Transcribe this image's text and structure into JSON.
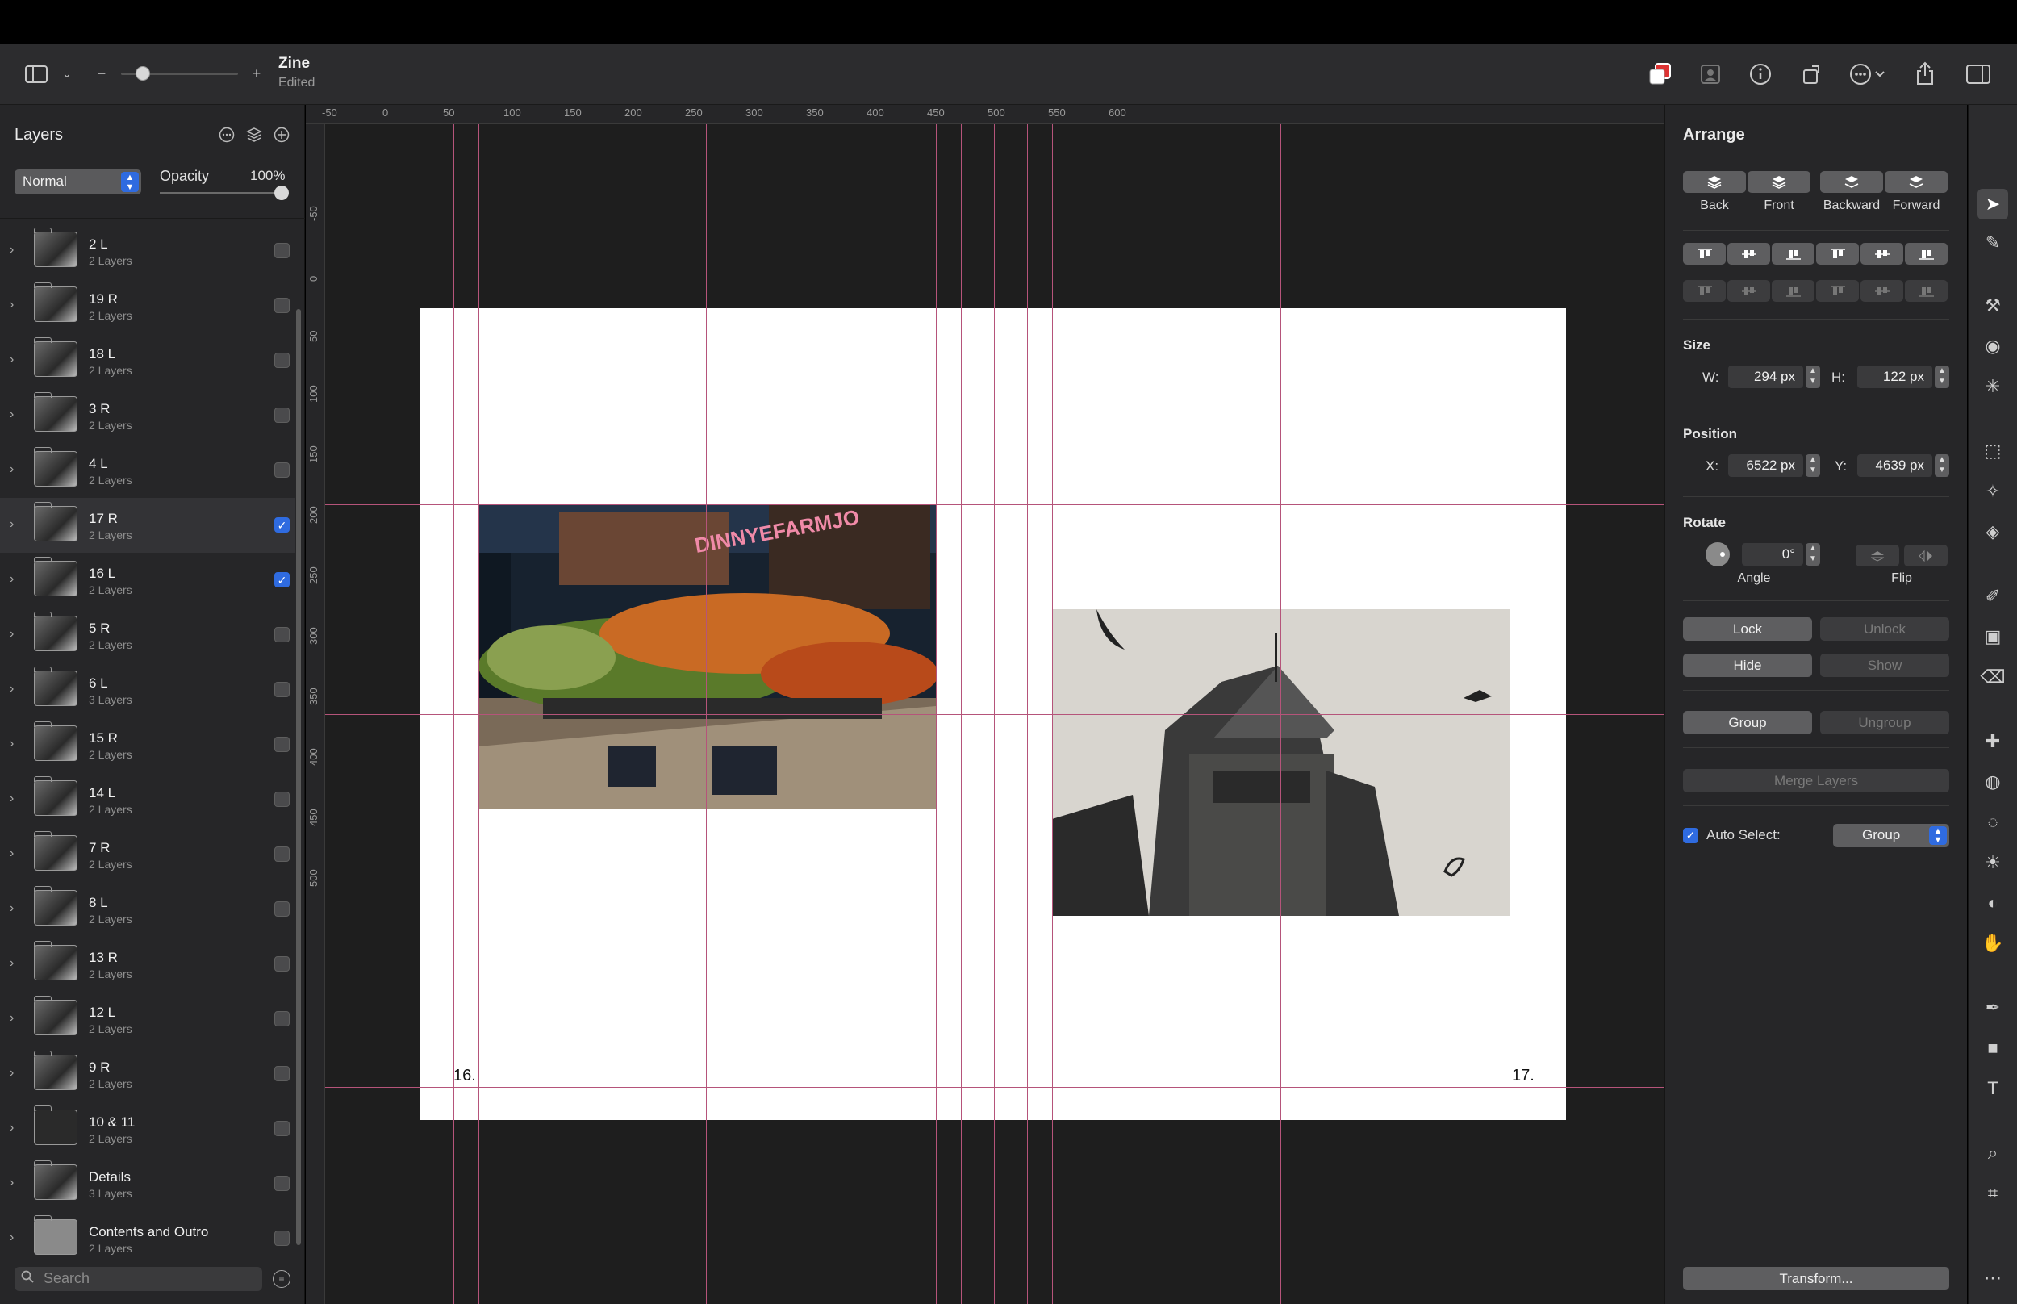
{
  "document": {
    "title": "Zine",
    "status": "Edited"
  },
  "toolbar": {
    "zoom_minus": "−",
    "zoom_plus": "+"
  },
  "layers_panel": {
    "title": "Layers",
    "blend_mode": "Normal",
    "opacity_label": "Opacity",
    "opacity_value": "100%",
    "search_placeholder": "Search",
    "layers": [
      {
        "name": "2 L",
        "count": "2 Layers",
        "visible": false,
        "selected": false
      },
      {
        "name": "19 R",
        "count": "2 Layers",
        "visible": false,
        "selected": false
      },
      {
        "name": "18 L",
        "count": "2 Layers",
        "visible": false,
        "selected": false
      },
      {
        "name": "3 R",
        "count": "2 Layers",
        "visible": false,
        "selected": false
      },
      {
        "name": "4 L",
        "count": "2 Layers",
        "visible": false,
        "selected": false
      },
      {
        "name": "17 R",
        "count": "2 Layers",
        "visible": true,
        "selected": true
      },
      {
        "name": "16 L",
        "count": "2 Layers",
        "visible": true,
        "selected": false
      },
      {
        "name": "5 R",
        "count": "2 Layers",
        "visible": false,
        "selected": false
      },
      {
        "name": "6 L",
        "count": "3 Layers",
        "visible": false,
        "selected": false
      },
      {
        "name": "15 R",
        "count": "2 Layers",
        "visible": false,
        "selected": false
      },
      {
        "name": "14 L",
        "count": "2 Layers",
        "visible": false,
        "selected": false
      },
      {
        "name": "7 R",
        "count": "2 Layers",
        "visible": false,
        "selected": false
      },
      {
        "name": "8 L",
        "count": "2 Layers",
        "visible": false,
        "selected": false
      },
      {
        "name": "13 R",
        "count": "2 Layers",
        "visible": false,
        "selected": false
      },
      {
        "name": "12 L",
        "count": "2 Layers",
        "visible": false,
        "selected": false
      },
      {
        "name": "9 R",
        "count": "2 Layers",
        "visible": false,
        "selected": false
      },
      {
        "name": "10 & 11",
        "count": "2 Layers",
        "visible": false,
        "selected": false
      },
      {
        "name": "Details",
        "count": "3 Layers",
        "visible": false,
        "selected": false
      },
      {
        "name": "Contents and Outro",
        "count": "2 Layers",
        "visible": false,
        "selected": false
      }
    ]
  },
  "canvas": {
    "ruler_top": [
      "-50",
      "0",
      "50",
      "100",
      "150",
      "200",
      "250",
      "300",
      "350",
      "400",
      "450",
      "500",
      "550",
      "600"
    ],
    "ruler_left": [
      "-50",
      "0",
      "50",
      "100",
      "150",
      "200",
      "250",
      "300",
      "350",
      "400",
      "450",
      "500"
    ],
    "page_left_number": "16.",
    "page_right_number": "17.",
    "market_sign": "DINNYEFARMJO"
  },
  "inspector": {
    "title": "Arrange",
    "order": {
      "back": "Back",
      "front": "Front",
      "backward": "Backward",
      "forward": "Forward"
    },
    "size_label": "Size",
    "w_label": "W:",
    "w_value": "294 px",
    "h_label": "H:",
    "h_value": "122 px",
    "position_label": "Position",
    "x_label": "X:",
    "x_value": "6522 px",
    "y_label": "Y:",
    "y_value": "4639 px",
    "rotate_label": "Rotate",
    "angle_value": "0°",
    "angle_label": "Angle",
    "flip_label": "Flip",
    "lock": "Lock",
    "unlock": "Unlock",
    "hide": "Hide",
    "show": "Show",
    "group": "Group",
    "ungroup": "Ungroup",
    "merge": "Merge Layers",
    "auto_select_label": "Auto Select:",
    "auto_select_value": "Group",
    "transform": "Transform..."
  },
  "colors": {
    "accent": "#2f6be0",
    "guide": "#b5547a",
    "panel": "#262628",
    "canvas": "#1e1e1e"
  }
}
